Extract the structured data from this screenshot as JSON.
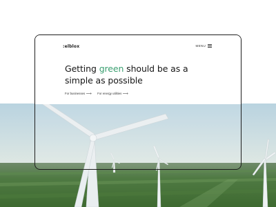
{
  "brand": {
    "logo": ":elblox"
  },
  "nav": {
    "menu_label": "MENU"
  },
  "hero": {
    "headline_before": "Getting ",
    "headline_accent": "green",
    "headline_after": " should be as a simple as possible",
    "accent_color": "#3a9f70"
  },
  "links": [
    {
      "label": "For businesses"
    },
    {
      "label": "For energy utilities"
    }
  ],
  "icons": {
    "menu": "hamburger-icon",
    "link_arrow": "arrow-right-icon"
  }
}
